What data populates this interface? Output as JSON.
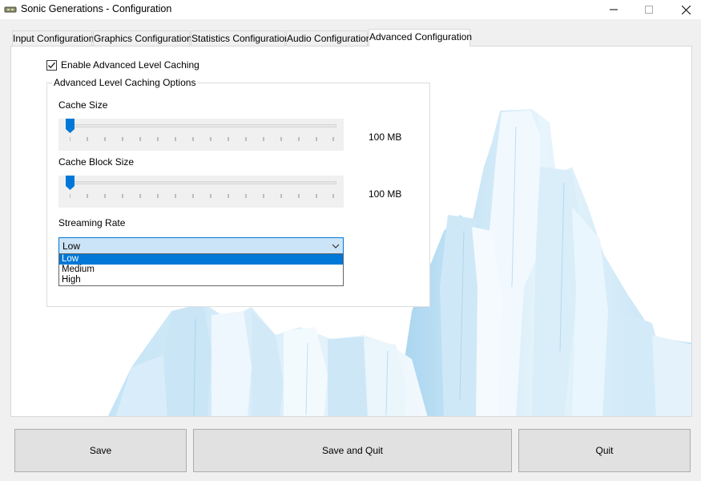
{
  "window": {
    "title": "Sonic Generations - Configuration",
    "controls": {
      "minimize": "—",
      "maximize": "☐",
      "close": "✕"
    }
  },
  "tabs": [
    {
      "label": "Input Configuration"
    },
    {
      "label": "Graphics Configuration"
    },
    {
      "label": "Statistics Configuration"
    },
    {
      "label": "Audio Configuration"
    },
    {
      "label": "Advanced Configuration",
      "active": true
    }
  ],
  "advanced": {
    "enable_caching": {
      "label": "Enable Advanced Level Caching",
      "checked": true
    },
    "group_title": "Advanced Level Caching Options",
    "cache_size": {
      "label": "Cache Size",
      "value": "100 MB",
      "slider_fraction": 0.0
    },
    "cache_block_size": {
      "label": "Cache Block Size",
      "value": "100 MB",
      "slider_fraction": 0.0
    },
    "streaming_rate": {
      "label": "Streaming Rate",
      "selected": "Low",
      "options": [
        "Low",
        "Medium",
        "High"
      ]
    }
  },
  "buttons": {
    "save": "Save",
    "save_quit": "Save and Quit",
    "quit": "Quit"
  },
  "colors": {
    "accent": "#0078d7",
    "selection_bg": "#cce4f7",
    "ice": "#cfe8f7"
  }
}
